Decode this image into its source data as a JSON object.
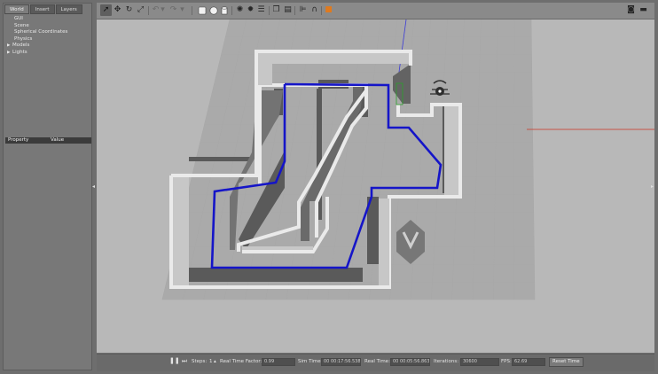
{
  "left_panel": {
    "tabs": [
      {
        "label": "World",
        "active": true
      },
      {
        "label": "Insert",
        "active": false
      },
      {
        "label": "Layers",
        "active": false
      }
    ],
    "tree": [
      {
        "label": "GUI",
        "expandable": false
      },
      {
        "label": "Scene",
        "expandable": false
      },
      {
        "label": "Spherical Coordinates",
        "expandable": false
      },
      {
        "label": "Physics",
        "expandable": false
      },
      {
        "label": "Models",
        "expandable": true
      },
      {
        "label": "Lights",
        "expandable": true
      }
    ],
    "property_header": {
      "property": "Property",
      "value": "Value"
    }
  },
  "toolbar": {
    "left_tools": [
      "select-arrow-icon",
      "translate-icon",
      "rotate-icon",
      "scale-icon",
      "undo-icon",
      "undo-dropdown-icon",
      "redo-icon",
      "redo-dropdown-icon",
      "box-shape-icon",
      "sphere-shape-icon",
      "cylinder-shape-icon",
      "point-light-icon",
      "spot-light-icon",
      "directional-light-icon",
      "copy-icon",
      "paste-icon",
      "align-icon",
      "snap-icon",
      "change-view-icon"
    ],
    "right_tools": [
      "screenshot-icon",
      "record-video-icon"
    ]
  },
  "bottom_bar": {
    "steps_label": "Steps:",
    "steps_value": "1",
    "real_time_factor_label": "Real Time Factor:",
    "real_time_factor_value": "0.99",
    "sim_time_label": "Sim Time:",
    "sim_time_value": "00 00:17:56.538",
    "real_time_label": "Real Time:",
    "real_time_value": "00 00:05:56.863",
    "iterations_label": "Iterations:",
    "iterations_value": "30600",
    "fps_label": "FPS:",
    "fps_value": "62.69",
    "reset_button": "Reset Time"
  },
  "colors": {
    "path": "#1515c8",
    "axis_x": "#cc3322",
    "axis_z": "#3a3ad8",
    "grid_line": "#a8a8a8"
  }
}
